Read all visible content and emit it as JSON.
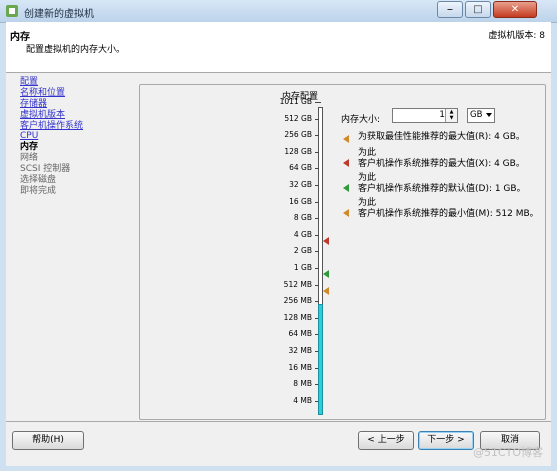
{
  "window": {
    "title": "创建新的虚拟机",
    "buttons": [
      "⎯",
      "□",
      "✕"
    ]
  },
  "header": {
    "title": "内存",
    "subtitle": "配置虚拟机的内存大小。",
    "version": "虚拟机版本: 8"
  },
  "nav": {
    "completed": [
      "配置",
      "名称和位置",
      "存储器",
      "虚拟机版本",
      "客户机操作系统",
      "CPU"
    ],
    "current": "内存",
    "upcoming": [
      "网络",
      "SCSI 控制器",
      "选择磁盘",
      "即将完成"
    ]
  },
  "memory_panel": {
    "group_title": "内存配置",
    "scale_labels": [
      "1011 GB",
      "512 GB",
      "256 GB",
      "128 GB",
      "64 GB",
      "32 GB",
      "16 GB",
      "8 GB",
      "4 GB",
      "2 GB",
      "1 GB",
      "512 MB",
      "256 MB",
      "128 MB",
      "64 MB",
      "32 MB",
      "16 MB",
      "8 MB",
      "4 MB"
    ],
    "filled_fraction": 0.36,
    "memory_size_label": "内存大小:",
    "memory_value": "1",
    "unit": "GB",
    "recommendations": [
      {
        "prefix": "",
        "text": "为获取最佳性能推荐的最大值(R): 4 GB。",
        "color": "#d08a2a"
      },
      {
        "prefix": "为此",
        "text": "客户机操作系统推荐的最大值(X): 4 GB。",
        "color": "#c0392b"
      },
      {
        "prefix": "为此",
        "text": "客户机操作系统推荐的默认值(D): 1 GB。",
        "color": "#2e9a3a"
      },
      {
        "prefix": "为此",
        "text": "客户机操作系统推荐的最小值(M): 512 MB。",
        "color": "#d08a2a"
      }
    ]
  },
  "footer": {
    "help": "帮助(H)",
    "back": "< 上一步",
    "next": "下一步 >",
    "cancel": "取消"
  },
  "watermark": "@51CTO博客"
}
